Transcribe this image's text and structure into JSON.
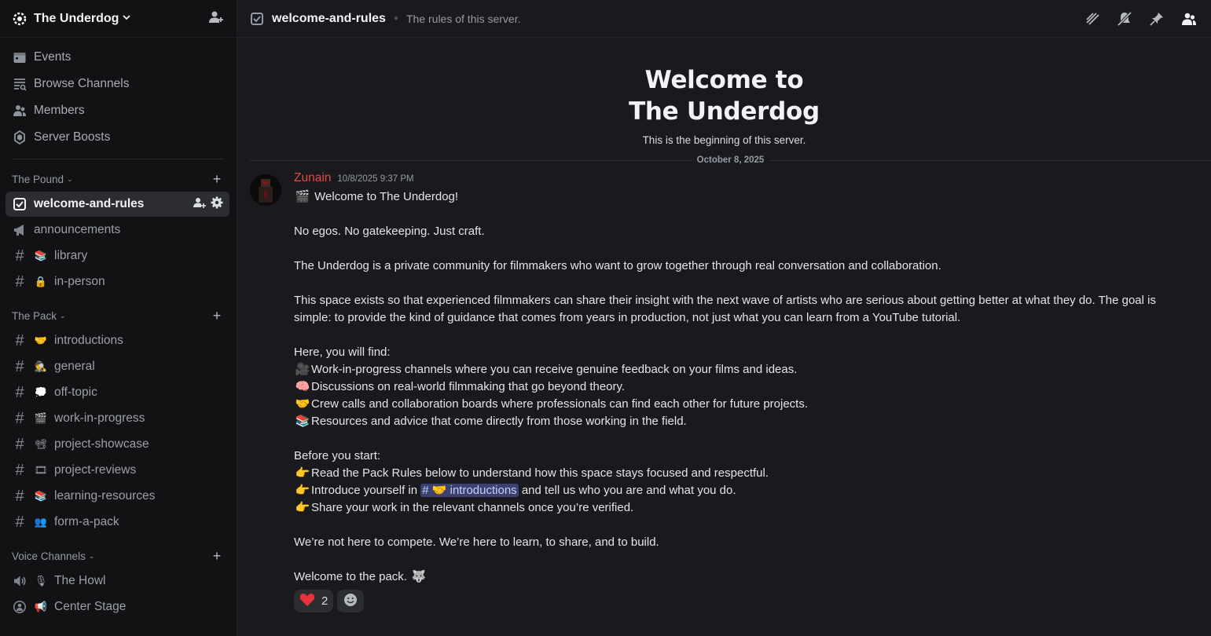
{
  "server": {
    "name": "The Underdog"
  },
  "nav": [
    {
      "label": "Events",
      "icon": "calendar-icon"
    },
    {
      "label": "Browse Channels",
      "icon": "browse-channels-icon"
    },
    {
      "label": "Members",
      "icon": "members-icon"
    },
    {
      "label": "Server Boosts",
      "icon": "boost-icon"
    }
  ],
  "categories": {
    "pound": {
      "name": "The Pound",
      "channels": [
        {
          "name": "welcome-and-rules",
          "icon": "rules-icon",
          "active": true
        },
        {
          "name": "announcements",
          "icon": "megaphone-icon"
        },
        {
          "name": "library",
          "emoji": "📚"
        },
        {
          "name": "in-person",
          "emoji": "🔒"
        }
      ]
    },
    "pack": {
      "name": "The Pack",
      "channels": [
        {
          "name": "introductions",
          "emoji": "🤝"
        },
        {
          "name": "general",
          "emoji": "🕵"
        },
        {
          "name": "off-topic",
          "emoji": "💭"
        },
        {
          "name": "work-in-progress",
          "emoji": "🎬"
        },
        {
          "name": "project-showcase",
          "emoji": "📽"
        },
        {
          "name": "project-reviews",
          "emoji": "🎞"
        },
        {
          "name": "learning-resources",
          "emoji": "📚"
        },
        {
          "name": "form-a-pack",
          "emoji": "👥"
        }
      ]
    },
    "voice": {
      "name": "Voice Channels",
      "channels": [
        {
          "name": "The Howl",
          "emoji": "🎙"
        },
        {
          "name": "Center Stage",
          "emoji": "📢"
        }
      ]
    }
  },
  "topbar": {
    "channel_name": "welcome-and-rules",
    "topic": "The rules of this server."
  },
  "welcome": {
    "title_line1": "Welcome to",
    "title_line2": "The Underdog",
    "subtitle": "This is the beginning of this server."
  },
  "date_divider": "October 8, 2025",
  "message": {
    "author": "Zunain",
    "timestamp": "10/8/2025 9:37 PM",
    "line_welcome": "Welcome to The Underdog!",
    "line_egos": "No egos. No gatekeeping. Just craft.",
    "line_private": "The Underdog is a private community for filmmakers who want to grow together through real conversation and collaboration.",
    "line_space_1": "This space exists so that experienced filmmakers can share their insight with the next wave of artists who are serious about getting better at what they do. The goal is",
    "line_space_2": "simple: to provide the kind of guidance that comes from years in production, not just what you can learn from a YouTube tutorial.",
    "line_find": "Here, you will find:",
    "bullets_find": [
      {
        "emoji": "🎥",
        "text": "Work-in-progress channels where you can receive genuine feedback on your films and ideas."
      },
      {
        "emoji": "🧠",
        "text": "Discussions on real-world filmmaking that go beyond theory."
      },
      {
        "emoji": "🤝",
        "text": "Crew calls and collaboration boards where professionals can find each other for future projects."
      },
      {
        "emoji": "📚",
        "text": "Resources and advice that come directly from those working in the field."
      }
    ],
    "line_before": "Before you start:",
    "bullet_read": "Read the Pack Rules below to understand how this space stays focused and respectful.",
    "bullet_intro_pre": "Introduce yourself in",
    "mention_channel": "introductions",
    "bullet_intro_post": "and tell us who you are and what you do.",
    "bullet_share": "Share your work in the relevant channels once you’re verified.",
    "line_compete": "We’re not here to compete. We’re here to learn, to share, and to build.",
    "line_pack": "Welcome to the pack.",
    "point_emoji": "👉",
    "clapper_emoji": "🎬",
    "wolf_emoji": "🐺"
  },
  "reaction": {
    "emoji": "❤️",
    "count": "2"
  }
}
